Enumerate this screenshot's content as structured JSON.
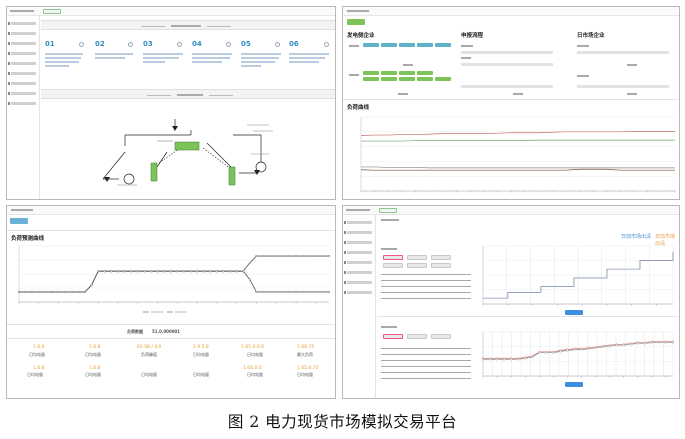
{
  "figure": {
    "caption": "图 2  电力现货市场模拟交易平台"
  },
  "panel_market_process": {
    "steps": [
      "01",
      "02",
      "03",
      "04",
      "05",
      "06"
    ]
  },
  "panel_bidding": {
    "section_generation": "发电侧企业",
    "section_demand": "申报流程",
    "section_retail": "日市场企业",
    "section_curve": "负荷曲线"
  },
  "panel_load_curve": {
    "title": "负荷预测曲线",
    "summary_label": "负荷数据",
    "summary_value": "51.0.000001",
    "stats": [
      {
        "value": "1.6.0",
        "label": "日均电量"
      },
      {
        "value": "1.6.8",
        "label": "日均电量"
      },
      {
        "value": "62.58 / 4.0",
        "label": "负荷峰值"
      },
      {
        "value": "1.9.5.8",
        "label": "日均电量"
      },
      {
        "value": "1.65.0.0.0",
        "label": "日均电量"
      },
      {
        "value": "1.68.75",
        "label": "最大负荷"
      },
      {
        "value": "1.6.8",
        "label": "日均电量"
      },
      {
        "value": "1.6.8",
        "label": "日均电量"
      },
      {
        "value": "",
        "label": "日均电量"
      },
      {
        "value": "",
        "label": "日均电量"
      },
      {
        "value": "1.64.0.0",
        "label": "日均电量"
      },
      {
        "value": "1.65.6.75",
        "label": "日均电量"
      }
    ]
  },
  "panel_clearing": {
    "title": "日前市场出清",
    "title_alt": "日前市场出清"
  },
  "chart_data": [
    {
      "type": "line",
      "title": "",
      "series": [
        {
          "name": "",
          "color": "#c86b6b",
          "values": [
            120,
            121,
            121,
            122,
            122,
            123,
            124,
            124,
            124,
            124,
            125,
            126,
            126,
            126,
            127,
            128,
            128,
            128,
            128,
            128,
            129,
            129,
            129,
            129
          ]
        },
        {
          "name": "",
          "color": "#6bae7a",
          "values": [
            108,
            108,
            108,
            108,
            109,
            109,
            109,
            109,
            109,
            109,
            109,
            109,
            109,
            110,
            110,
            110,
            110,
            110,
            110,
            110,
            110,
            110,
            110,
            110
          ]
        },
        {
          "name": "",
          "color": "#888888",
          "values": [
            52,
            52,
            51,
            51,
            51,
            50,
            50,
            50,
            50,
            50,
            50,
            50,
            50,
            50,
            50,
            50,
            50,
            50,
            50,
            50,
            50,
            50,
            50,
            50
          ]
        },
        {
          "name": "",
          "color": "#7a4b3b",
          "values": [
            46,
            45,
            45,
            45,
            45,
            45,
            45,
            45,
            45,
            45,
            45,
            45,
            45,
            45,
            45,
            45,
            47,
            47,
            47,
            45,
            45,
            45,
            45,
            45
          ]
        }
      ],
      "ylim": [
        0,
        160
      ]
    },
    {
      "type": "line",
      "title": "",
      "series": [
        {
          "name": "",
          "color": "#555555",
          "values": [
            18,
            18,
            18,
            18,
            18,
            18,
            18,
            18,
            18,
            18,
            18,
            30,
            55,
            55,
            55,
            55,
            55,
            55,
            55,
            55,
            55,
            55,
            55,
            55,
            55,
            55,
            55,
            55,
            55,
            55,
            55,
            55,
            55,
            55,
            55,
            70,
            82,
            82,
            82,
            82,
            82,
            82,
            82,
            82,
            82,
            82,
            82,
            82
          ]
        },
        {
          "name": "",
          "color": "#555555",
          "values": [
            18,
            18,
            18,
            18,
            18,
            18,
            18,
            18,
            18,
            18,
            18,
            30,
            55,
            55,
            55,
            55,
            55,
            55,
            55,
            55,
            55,
            55,
            55,
            55,
            55,
            55,
            55,
            55,
            55,
            55,
            55,
            55,
            55,
            55,
            55,
            40,
            18,
            18,
            18,
            18,
            18,
            18,
            18,
            18,
            18,
            18,
            18,
            18
          ]
        }
      ],
      "ylim": [
        0,
        100
      ]
    },
    {
      "type": "line",
      "title": "",
      "series": [
        {
          "name": "",
          "color": "#d27878",
          "values": [
            10,
            10,
            10,
            20,
            20,
            20,
            20,
            30,
            30,
            30,
            30,
            45,
            45,
            45,
            45,
            60,
            60,
            60,
            60,
            75,
            75,
            75,
            75,
            90
          ]
        },
        {
          "name": "",
          "color": "#7a9aca",
          "values": [
            10,
            10,
            10,
            20,
            20,
            20,
            20,
            30,
            30,
            30,
            30,
            45,
            45,
            45,
            45,
            60,
            60,
            60,
            60,
            75,
            75,
            75,
            75,
            90
          ]
        }
      ],
      "ylim": [
        0,
        100
      ]
    },
    {
      "type": "line",
      "title": "",
      "series": [
        {
          "name": "",
          "color": "#d27878",
          "values": [
            40,
            40,
            40,
            40,
            40,
            40,
            42,
            45,
            55,
            55,
            55,
            58,
            60,
            62,
            62,
            64,
            66,
            68,
            70,
            72,
            72,
            74,
            76,
            76,
            78,
            78,
            78,
            78
          ]
        },
        {
          "name": "",
          "color": "#8a8a8a",
          "values": [
            38,
            38,
            38,
            38,
            38,
            38,
            40,
            43,
            53,
            53,
            53,
            56,
            58,
            60,
            60,
            62,
            64,
            66,
            68,
            70,
            70,
            72,
            74,
            74,
            76,
            76,
            76,
            76
          ]
        }
      ],
      "ylim": [
        0,
        100
      ]
    }
  ]
}
